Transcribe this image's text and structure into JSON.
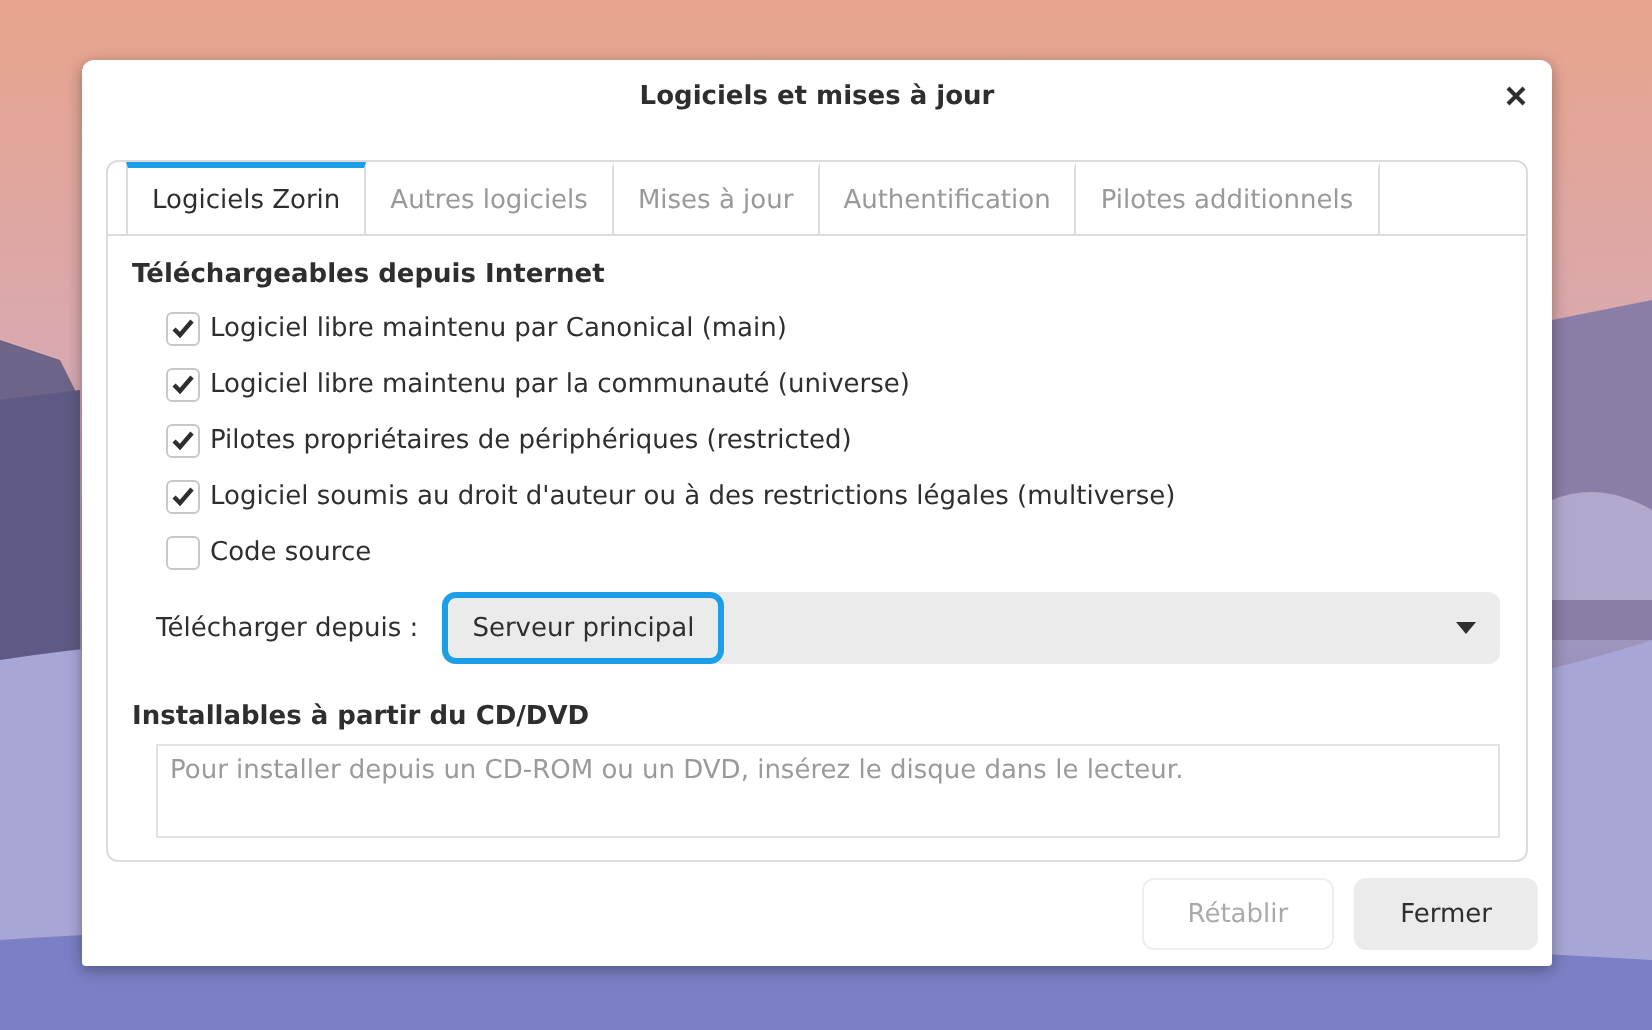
{
  "window": {
    "title": "Logiciels et mises à jour"
  },
  "tabs": [
    {
      "label": "Logiciels Zorin",
      "selected": true
    },
    {
      "label": "Autres logiciels",
      "selected": false
    },
    {
      "label": "Mises à jour",
      "selected": false
    },
    {
      "label": "Authentification",
      "selected": false
    },
    {
      "label": "Pilotes additionnels",
      "selected": false
    }
  ],
  "internet": {
    "heading": "Téléchargeables depuis Internet",
    "sources": [
      {
        "label": "Logiciel libre maintenu par Canonical (main)",
        "checked": true
      },
      {
        "label": "Logiciel libre maintenu par la communauté (universe)",
        "checked": true
      },
      {
        "label": "Pilotes propriétaires de périphériques (restricted)",
        "checked": true
      },
      {
        "label": "Logiciel soumis au droit d'auteur ou à des restrictions légales (multiverse)",
        "checked": true
      },
      {
        "label": "Code source",
        "checked": false
      }
    ],
    "download_from": {
      "label": "Télécharger depuis :",
      "value": "Serveur principal"
    }
  },
  "cdrom": {
    "heading": "Installables à partir du CD/DVD",
    "message": "Pour installer depuis un CD-ROM ou un DVD, insérez le disque dans le lecteur."
  },
  "buttons": [
    {
      "label": "Rétablir",
      "disabled": true
    },
    {
      "label": "Fermer",
      "disabled": false
    }
  ]
}
